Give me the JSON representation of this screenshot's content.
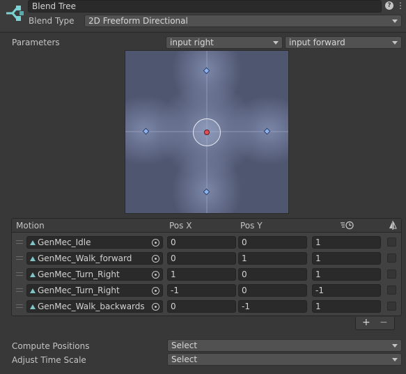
{
  "header": {
    "name_value": "Blend Tree",
    "help_icon": "help-icon",
    "menu_icon": "kebab-menu-icon",
    "tree_icon": "blend-tree-icon"
  },
  "blend_type": {
    "label": "Blend Type",
    "value": "2D Freeform Directional"
  },
  "parameters": {
    "label": "Parameters",
    "param_x": "input right",
    "param_y": "input forward"
  },
  "blend_space": {
    "accent_point_color": "#8fb2f0",
    "current_position_color": "#e0525a",
    "sample_points": [
      {
        "x": 0,
        "y": 1
      },
      {
        "x": 1,
        "y": 0
      },
      {
        "x": -1,
        "y": 0
      },
      {
        "x": 0,
        "y": -1
      }
    ],
    "current": {
      "x": 0,
      "y": 0
    }
  },
  "motion_list": {
    "columns": {
      "motion": "Motion",
      "pos_x": "Pos X",
      "pos_y": "Pos Y",
      "speed_icon": "time-speed-icon",
      "mirror_icon": "mirror-icon"
    },
    "rows": [
      {
        "motion": "GenMec_Idle",
        "pos_x": "0",
        "pos_y": "0",
        "speed": "1"
      },
      {
        "motion": "GenMec_Walk_forward",
        "pos_x": "0",
        "pos_y": "1",
        "speed": "1"
      },
      {
        "motion": "GenMec_Turn_Right",
        "pos_x": "1",
        "pos_y": "0",
        "speed": "1"
      },
      {
        "motion": "GenMec_Turn_Right",
        "pos_x": "-1",
        "pos_y": "0",
        "speed": "-1"
      },
      {
        "motion": "GenMec_Walk_backwards",
        "pos_x": "0",
        "pos_y": "-1",
        "speed": "1"
      }
    ],
    "add_label": "+",
    "remove_label": "−"
  },
  "compute_positions": {
    "label": "Compute Positions",
    "value": "Select"
  },
  "adjust_time_scale": {
    "label": "Adjust Time Scale",
    "value": "Select"
  }
}
